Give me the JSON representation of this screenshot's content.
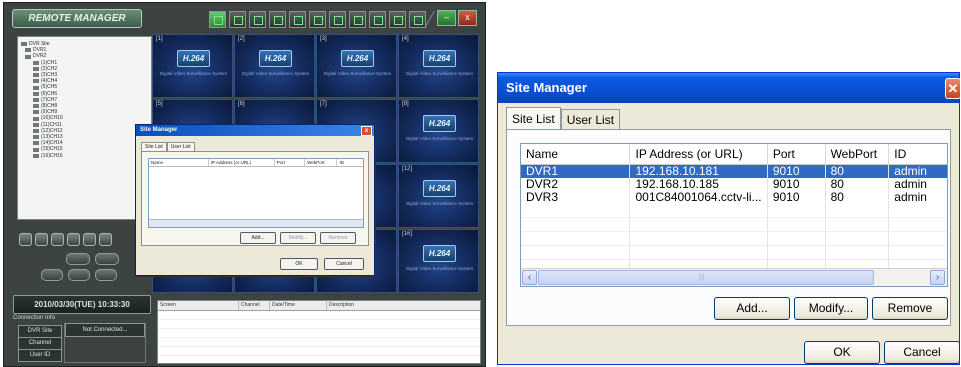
{
  "remote_manager": {
    "title": "REMOTE MANAGER",
    "tree": [
      "DVR Site",
      "DVR1",
      "DVR2",
      "(1)CH1",
      "(2)CH2",
      "(3)CH3",
      "(4)CH4",
      "(5)CH5",
      "(6)CH6",
      "(7)CH7",
      "(8)CH8",
      "(9)CH9",
      "(10)CH10",
      "(11)CH11",
      "(12)CH12",
      "(13)CH13",
      "(14)CH14",
      "(15)CH15",
      "(16)CH16"
    ],
    "cameras": [
      {
        "num": "[1]",
        "logo": "H.264",
        "sub": "Digital Video Surveillance System"
      },
      {
        "num": "[2]",
        "logo": "H.264",
        "sub": "Digital Video Surveillance System"
      },
      {
        "num": "[3]",
        "logo": "H.264",
        "sub": "Digital Video Surveillance System"
      },
      {
        "num": "[4]",
        "logo": "H.264",
        "sub": "Digital Video Surveillance System"
      },
      {
        "num": "[5]",
        "logo": "",
        "sub": ""
      },
      {
        "num": "[6]",
        "logo": "",
        "sub": ""
      },
      {
        "num": "[7]",
        "logo": "",
        "sub": ""
      },
      {
        "num": "[8]",
        "logo": "H.264",
        "sub": "Digital Video Surveillance System"
      },
      {
        "num": "",
        "logo": "",
        "sub": ""
      },
      {
        "num": "",
        "logo": "",
        "sub": ""
      },
      {
        "num": "",
        "logo": "",
        "sub": ""
      },
      {
        "num": "[12]",
        "logo": "H.264",
        "sub": "Digital Video Surveillance System"
      },
      {
        "num": "",
        "logo": "",
        "sub": ""
      },
      {
        "num": "",
        "logo": "",
        "sub": ""
      },
      {
        "num": "",
        "logo": "",
        "sub": ""
      },
      {
        "num": "[16]",
        "logo": "H.264",
        "sub": "Digital Video Surveillance System"
      }
    ],
    "datetime": "2010/03/30(TUE) 10:33:30",
    "connection_info_label": "Connection Info",
    "connection_rows": [
      "DVR Site",
      "Channel",
      "User ID"
    ],
    "connection_value": "Not Connected...",
    "event_headers": [
      "Screen",
      "Channel",
      "Date/Time",
      "Description"
    ],
    "mini_dialog": {
      "title": "Site Manager",
      "tabs": [
        "Site List",
        "User List"
      ],
      "headers": [
        "Name",
        "IP Address (or URL)",
        "Port",
        "WebPort",
        "ID"
      ],
      "buttons": {
        "add": "Add...",
        "modify": "Modify...",
        "remove": "Remove",
        "ok": "OK",
        "cancel": "Cancel"
      }
    }
  },
  "site_manager": {
    "title": "Site Manager",
    "close_glyph": "✕",
    "tabs": {
      "site_list": "Site List",
      "user_list": "User List"
    },
    "columns": {
      "name": "Name",
      "ip": "IP Address (or URL)",
      "port": "Port",
      "webport": "WebPort",
      "id": "ID"
    },
    "rows": [
      {
        "name": "DVR1",
        "ip": "192.168.10.181",
        "port": "9010",
        "webport": "80",
        "id": "admin",
        "selected": true
      },
      {
        "name": "DVR2",
        "ip": "192.168.10.185",
        "port": "9010",
        "webport": "80",
        "id": "admin",
        "selected": false
      },
      {
        "name": "DVR3",
        "ip": "001C84001064.cctv-li...",
        "port": "9010",
        "webport": "80",
        "id": "admin",
        "selected": false
      }
    ],
    "buttons": {
      "add": "Add...",
      "modify": "Modify...",
      "remove": "Remove",
      "ok": "OK",
      "cancel": "Cancel"
    },
    "scroll_left": "‹",
    "scroll_right": "›",
    "scroll_grip": "|||"
  },
  "colors": {
    "selection": "#316ac5",
    "title_blue": "#0a4fd2",
    "app_bg": "#3c4341"
  }
}
